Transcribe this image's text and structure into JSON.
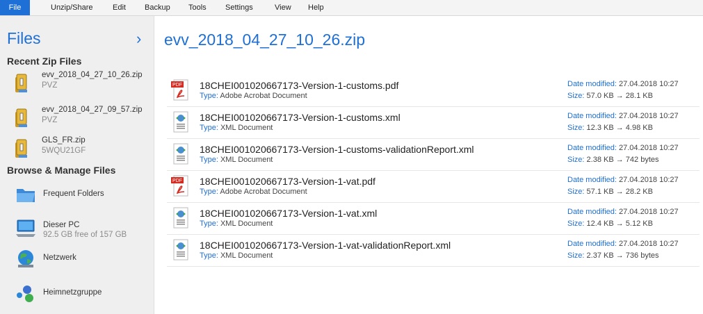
{
  "menu": {
    "file": "File",
    "unzip_share": "Unzip/Share",
    "edit": "Edit",
    "backup": "Backup",
    "tools": "Tools",
    "settings": "Settings",
    "view": "View",
    "help": "Help"
  },
  "sidebar": {
    "title": "Files",
    "chevron": "›",
    "recent_heading": "Recent Zip Files",
    "recent": [
      {
        "name": "evv_2018_04_27_10_26.zip",
        "sub": "PVZ"
      },
      {
        "name": "evv_2018_04_27_09_57.zip",
        "sub": "PVZ"
      },
      {
        "name": "GLS_FR.zip",
        "sub": "5WQU21GF"
      }
    ],
    "manage_heading": "Browse & Manage Files",
    "manage": [
      {
        "name": "Frequent Folders",
        "sub": "",
        "icon": "folder-icon"
      },
      {
        "name": "Dieser PC",
        "sub": "92.5 GB free of 157 GB",
        "icon": "computer-icon"
      },
      {
        "name": "Netzwerk",
        "sub": "",
        "icon": "network-globe-icon"
      },
      {
        "name": "Heimnetzgruppe",
        "sub": "",
        "icon": "homegroup-icon"
      }
    ]
  },
  "main": {
    "title": "evv_2018_04_27_10_26.zip",
    "labels": {
      "type": "Type:",
      "date": "Date modified:",
      "size": "Size:",
      "arrow": "→"
    },
    "files": [
      {
        "name": "18CHEI001020667173-Version-1-customs.pdf",
        "type": "Adobe Acrobat Document",
        "date": "27.04.2018 10:27",
        "size_from": "57.0 KB",
        "size_to": "28.1 KB",
        "icon": "pdf-icon"
      },
      {
        "name": "18CHEI001020667173-Version-1-customs.xml",
        "type": "XML Document",
        "date": "27.04.2018 10:27",
        "size_from": "12.3 KB",
        "size_to": "4.98 KB",
        "icon": "xml-icon"
      },
      {
        "name": "18CHEI001020667173-Version-1-customs-validationReport.xml",
        "type": "XML Document",
        "date": "27.04.2018 10:27",
        "size_from": "2.38 KB",
        "size_to": "742 bytes",
        "icon": "xml-icon"
      },
      {
        "name": "18CHEI001020667173-Version-1-vat.pdf",
        "type": "Adobe Acrobat Document",
        "date": "27.04.2018 10:27",
        "size_from": "57.1 KB",
        "size_to": "28.2 KB",
        "icon": "pdf-icon"
      },
      {
        "name": "18CHEI001020667173-Version-1-vat.xml",
        "type": "XML Document",
        "date": "27.04.2018 10:27",
        "size_from": "12.4 KB",
        "size_to": "5.12 KB",
        "icon": "xml-icon"
      },
      {
        "name": "18CHEI001020667173-Version-1-vat-validationReport.xml",
        "type": "XML Document",
        "date": "27.04.2018 10:27",
        "size_from": "2.37 KB",
        "size_to": "736 bytes",
        "icon": "xml-icon"
      }
    ],
    "pdf_badge": "PDF"
  },
  "colors": {
    "accent": "#1e6fd6",
    "menu_active": "#1e6fd6",
    "sidebar_bg": "#efefef"
  }
}
